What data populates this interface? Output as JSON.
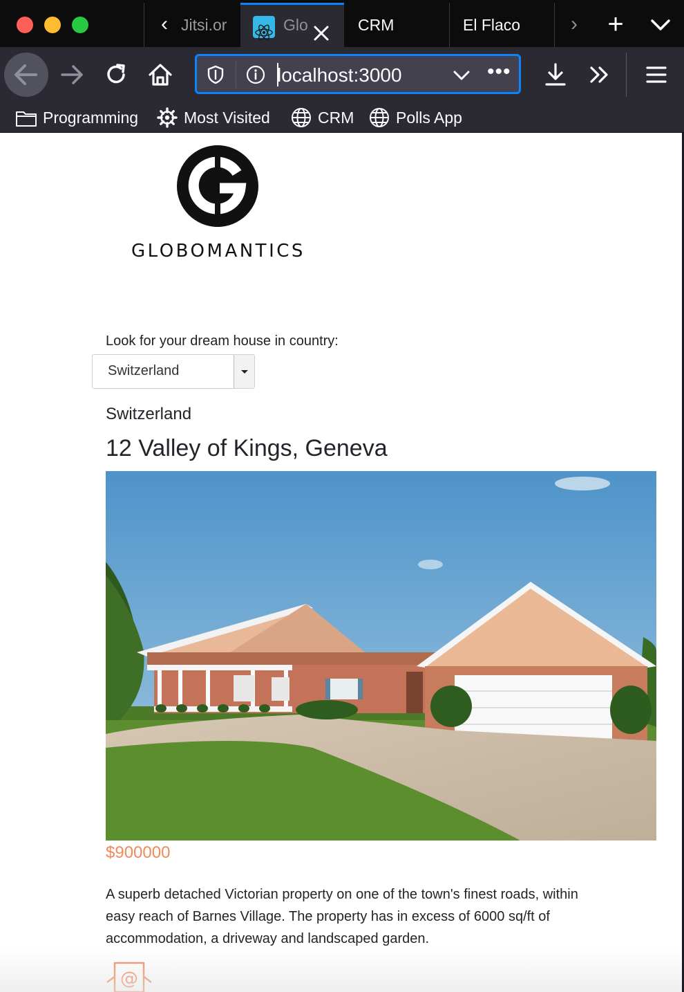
{
  "browser": {
    "tabs": [
      {
        "label": "Jitsi.or",
        "state": "partial"
      },
      {
        "label": "Glo",
        "state": "active",
        "icon": "react-icon"
      },
      {
        "label": "CRM",
        "state": "inactive"
      },
      {
        "label": "El Flaco",
        "state": "inactive"
      }
    ],
    "url": "localhost:3000",
    "more_symbol": "•••",
    "bookmarks": [
      {
        "label": "Programming",
        "icon": "folder-icon"
      },
      {
        "label": "Most Visited",
        "icon": "gear-icon"
      },
      {
        "label": "CRM",
        "icon": "globe-icon"
      },
      {
        "label": "Polls App",
        "icon": "globe-icon"
      }
    ],
    "colors": {
      "accent": "#0a84ff",
      "toolbar": "#2b2a33",
      "tabstrip": "#0c0c0d"
    }
  },
  "page": {
    "logo_text": "GLOBOMANTICS",
    "country_label": "Look for your dream house in country:",
    "country_select_value": "Switzerland",
    "house": {
      "country": "Switzerland",
      "address": "12 Valley of Kings, Geneva",
      "price": "$900000",
      "description": "A superb detached Victorian property on one of the town's finest roads, within easy reach of Barnes Village. The property has in excess of 6000 sq/ft of accommodation, a driveway and landscaped garden."
    },
    "colors": {
      "price": "#f08a5d",
      "text": "#212529"
    }
  }
}
